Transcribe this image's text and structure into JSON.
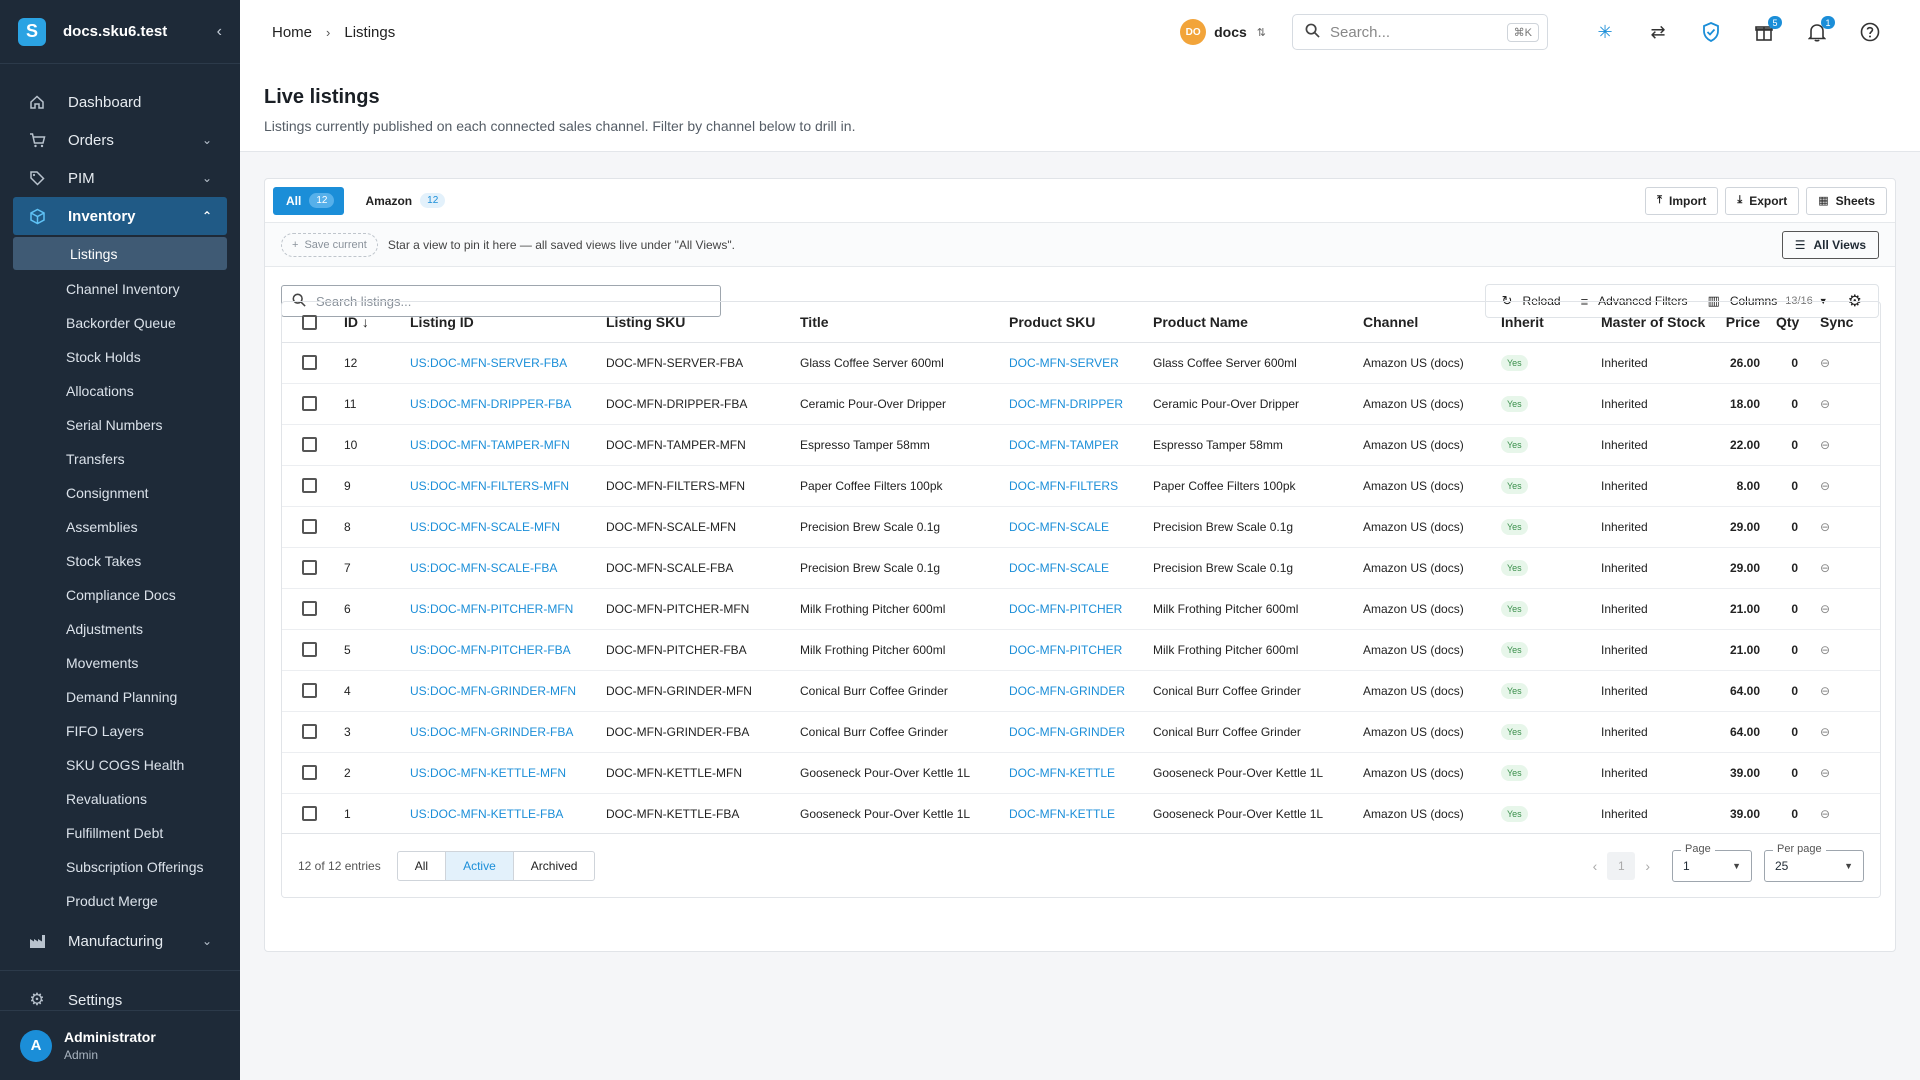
{
  "app": {
    "workspace_title": "docs.sku6.test",
    "logo_letter": "S"
  },
  "sidebar": {
    "items_top": [
      {
        "label": "Dashboard",
        "icon": "home-icon"
      },
      {
        "label": "Orders",
        "icon": "cart-icon",
        "chevron": true
      },
      {
        "label": "PIM",
        "icon": "tag-icon",
        "chevron": true
      }
    ],
    "inventory": {
      "label": "Inventory",
      "icon": "box-icon"
    },
    "inventory_sub": [
      "Listings",
      "Channel Inventory",
      "Backorder Queue",
      "Stock Holds",
      "Allocations",
      "Serial Numbers",
      "Transfers",
      "Consignment",
      "Assemblies",
      "Stock Takes",
      "Compliance Docs",
      "Adjustments",
      "Movements",
      "Demand Planning",
      "FIFO Layers",
      "SKU COGS Health",
      "Revaluations",
      "Fulfillment Debt",
      "Subscription Offerings",
      "Product Merge"
    ],
    "manufacturing": "Manufacturing",
    "settings": "Settings",
    "user": {
      "initial": "A",
      "name": "Administrator",
      "role": "Admin"
    }
  },
  "topbar": {
    "breadcrumb": [
      "Home",
      "Listings"
    ],
    "workspace": {
      "initials": "DO",
      "name": "docs"
    },
    "search_placeholder": "Search...",
    "search_shortcut": "⌘K",
    "gift_badge": "5",
    "bell_badge": "1"
  },
  "page": {
    "title": "Live listings",
    "subtitle": "Listings currently published on each connected sales channel. Filter by channel below to drill in."
  },
  "tabs": [
    {
      "label": "All",
      "count": "12",
      "active": true
    },
    {
      "label": "Amazon",
      "count": "12",
      "active": false
    }
  ],
  "actions": {
    "import": "Import",
    "export": "Export",
    "sheets": "Sheets"
  },
  "views": {
    "save_current": "Save current",
    "hint": "Star a view to pin it here — all saved views live under \"All Views\".",
    "all_views": "All Views"
  },
  "filters": {
    "search_placeholder": "Search listings...",
    "reload": "Reload",
    "advanced": "Advanced Filters",
    "columns": "Columns",
    "columns_count": "13/16"
  },
  "table": {
    "columns": [
      "ID",
      "Listing ID",
      "Listing SKU",
      "Title",
      "Product SKU",
      "Product Name",
      "Channel",
      "Inherit",
      "Master of Stock",
      "Price",
      "Qty",
      "Sync"
    ],
    "rows": [
      {
        "id": "12",
        "listing_id": "US:DOC-MFN-SERVER-FBA",
        "listing_sku": "DOC-MFN-SERVER-FBA",
        "title": "Glass Coffee Server 600ml",
        "product_sku": "DOC-MFN-SERVER",
        "product_name": "Glass Coffee Server 600ml",
        "channel": "Amazon US (docs)",
        "inherit": "Yes",
        "master": "Inherited",
        "price": "26.00",
        "qty": "0"
      },
      {
        "id": "11",
        "listing_id": "US:DOC-MFN-DRIPPER-FBA",
        "listing_sku": "DOC-MFN-DRIPPER-FBA",
        "title": "Ceramic Pour-Over Dripper",
        "product_sku": "DOC-MFN-DRIPPER",
        "product_name": "Ceramic Pour-Over Dripper",
        "channel": "Amazon US (docs)",
        "inherit": "Yes",
        "master": "Inherited",
        "price": "18.00",
        "qty": "0"
      },
      {
        "id": "10",
        "listing_id": "US:DOC-MFN-TAMPER-MFN",
        "listing_sku": "DOC-MFN-TAMPER-MFN",
        "title": "Espresso Tamper 58mm",
        "product_sku": "DOC-MFN-TAMPER",
        "product_name": "Espresso Tamper 58mm",
        "channel": "Amazon US (docs)",
        "inherit": "Yes",
        "master": "Inherited",
        "price": "22.00",
        "qty": "0"
      },
      {
        "id": "9",
        "listing_id": "US:DOC-MFN-FILTERS-MFN",
        "listing_sku": "DOC-MFN-FILTERS-MFN",
        "title": "Paper Coffee Filters 100pk",
        "product_sku": "DOC-MFN-FILTERS",
        "product_name": "Paper Coffee Filters 100pk",
        "channel": "Amazon US (docs)",
        "inherit": "Yes",
        "master": "Inherited",
        "price": "8.00",
        "qty": "0"
      },
      {
        "id": "8",
        "listing_id": "US:DOC-MFN-SCALE-MFN",
        "listing_sku": "DOC-MFN-SCALE-MFN",
        "title": "Precision Brew Scale 0.1g",
        "product_sku": "DOC-MFN-SCALE",
        "product_name": "Precision Brew Scale 0.1g",
        "channel": "Amazon US (docs)",
        "inherit": "Yes",
        "master": "Inherited",
        "price": "29.00",
        "qty": "0"
      },
      {
        "id": "7",
        "listing_id": "US:DOC-MFN-SCALE-FBA",
        "listing_sku": "DOC-MFN-SCALE-FBA",
        "title": "Precision Brew Scale 0.1g",
        "product_sku": "DOC-MFN-SCALE",
        "product_name": "Precision Brew Scale 0.1g",
        "channel": "Amazon US (docs)",
        "inherit": "Yes",
        "master": "Inherited",
        "price": "29.00",
        "qty": "0"
      },
      {
        "id": "6",
        "listing_id": "US:DOC-MFN-PITCHER-MFN",
        "listing_sku": "DOC-MFN-PITCHER-MFN",
        "title": "Milk Frothing Pitcher 600ml",
        "product_sku": "DOC-MFN-PITCHER",
        "product_name": "Milk Frothing Pitcher 600ml",
        "channel": "Amazon US (docs)",
        "inherit": "Yes",
        "master": "Inherited",
        "price": "21.00",
        "qty": "0"
      },
      {
        "id": "5",
        "listing_id": "US:DOC-MFN-PITCHER-FBA",
        "listing_sku": "DOC-MFN-PITCHER-FBA",
        "title": "Milk Frothing Pitcher 600ml",
        "product_sku": "DOC-MFN-PITCHER",
        "product_name": "Milk Frothing Pitcher 600ml",
        "channel": "Amazon US (docs)",
        "inherit": "Yes",
        "master": "Inherited",
        "price": "21.00",
        "qty": "0"
      },
      {
        "id": "4",
        "listing_id": "US:DOC-MFN-GRINDER-MFN",
        "listing_sku": "DOC-MFN-GRINDER-MFN",
        "title": "Conical Burr Coffee Grinder",
        "product_sku": "DOC-MFN-GRINDER",
        "product_name": "Conical Burr Coffee Grinder",
        "channel": "Amazon US (docs)",
        "inherit": "Yes",
        "master": "Inherited",
        "price": "64.00",
        "qty": "0"
      },
      {
        "id": "3",
        "listing_id": "US:DOC-MFN-GRINDER-FBA",
        "listing_sku": "DOC-MFN-GRINDER-FBA",
        "title": "Conical Burr Coffee Grinder",
        "product_sku": "DOC-MFN-GRINDER",
        "product_name": "Conical Burr Coffee Grinder",
        "channel": "Amazon US (docs)",
        "inherit": "Yes",
        "master": "Inherited",
        "price": "64.00",
        "qty": "0"
      },
      {
        "id": "2",
        "listing_id": "US:DOC-MFN-KETTLE-MFN",
        "listing_sku": "DOC-MFN-KETTLE-MFN",
        "title": "Gooseneck Pour-Over Kettle 1L",
        "product_sku": "DOC-MFN-KETTLE",
        "product_name": "Gooseneck Pour-Over Kettle 1L",
        "channel": "Amazon US (docs)",
        "inherit": "Yes",
        "master": "Inherited",
        "price": "39.00",
        "qty": "0"
      },
      {
        "id": "1",
        "listing_id": "US:DOC-MFN-KETTLE-FBA",
        "listing_sku": "DOC-MFN-KETTLE-FBA",
        "title": "Gooseneck Pour-Over Kettle 1L",
        "product_sku": "DOC-MFN-KETTLE",
        "product_name": "Gooseneck Pour-Over Kettle 1L",
        "channel": "Amazon US (docs)",
        "inherit": "Yes",
        "master": "Inherited",
        "price": "39.00",
        "qty": "0"
      }
    ]
  },
  "footer": {
    "entries": "12 of 12 entries",
    "segments": [
      "All",
      "Active",
      "Archived"
    ],
    "active_segment": "Active",
    "current_page": "1",
    "page_label": "Page",
    "page_value": "1",
    "per_page_label": "Per page",
    "per_page_value": "25"
  },
  "colors": {
    "accent": "#1b8ed8",
    "sidebar_bg": "#1e2a38",
    "active_nav": "#205a86"
  }
}
